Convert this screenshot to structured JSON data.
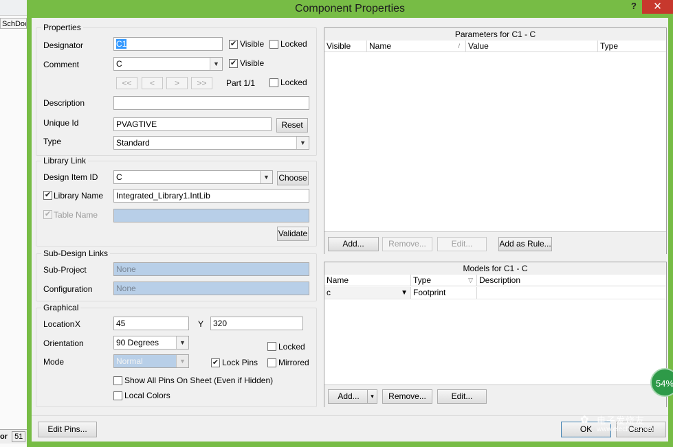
{
  "background_app": {
    "tab_label": "SchDoc",
    "bottom_left_label": "or",
    "bottom_tab_label": "51"
  },
  "dialog": {
    "title": "Component Properties",
    "help_label": "?",
    "close_label": "✕"
  },
  "properties": {
    "group_label": "Properties",
    "designator_label": "Designator",
    "designator_value": "C1",
    "designator_visible": "Visible",
    "designator_locked": "Locked",
    "comment_label": "Comment",
    "comment_value": "C",
    "comment_visible": "Visible",
    "nav_first": "<<",
    "nav_prev": "<",
    "nav_next": ">",
    "nav_last": ">>",
    "part_label": "Part 1/1",
    "part_locked": "Locked",
    "description_label": "Description",
    "description_value": "",
    "unique_id_label": "Unique Id",
    "unique_id_value": "PVAGTIVE",
    "reset_button": "Reset",
    "type_label": "Type",
    "type_value": "Standard"
  },
  "library_link": {
    "group_label": "Library Link",
    "design_item_label": "Design Item ID",
    "design_item_value": "C",
    "choose_button": "Choose",
    "library_name_label": "Library Name",
    "library_name_value": "Integrated_Library1.IntLib",
    "table_name_label": "Table Name",
    "validate_button": "Validate"
  },
  "sub_design": {
    "group_label": "Sub-Design Links",
    "sub_project_label": "Sub-Project",
    "sub_project_value": "None",
    "configuration_label": "Configuration",
    "configuration_value": "None"
  },
  "graphical": {
    "group_label": "Graphical",
    "location_label": "Location",
    "x_label": "X",
    "x_value": "45",
    "y_label": "Y",
    "y_value": "320",
    "orientation_label": "Orientation",
    "orientation_value": "90 Degrees",
    "locked_label": "Locked",
    "mode_label": "Mode",
    "mode_value": "Normal",
    "lock_pins_label": "Lock Pins",
    "mirrored_label": "Mirrored",
    "show_all_pins_label": "Show All Pins On Sheet (Even if Hidden)",
    "local_colors_label": "Local Colors"
  },
  "parameters": {
    "header": "Parameters for C1 - C",
    "columns": [
      "Visible",
      "Name",
      "Value",
      "Type"
    ],
    "sort_glyph": "/",
    "add_button": "Add...",
    "remove_button": "Remove...",
    "edit_button": "Edit...",
    "add_as_rule_button": "Add as Rule..."
  },
  "models": {
    "header": "Models for C1 - C",
    "columns": [
      "Name",
      "Type",
      "Description"
    ],
    "sort_glyph": "▽",
    "row": {
      "name": "c",
      "type": "Footprint",
      "description": ""
    },
    "add_button": "Add...",
    "add_dropdown": "▾",
    "remove_button": "Remove...",
    "edit_button": "Edit..."
  },
  "footer": {
    "edit_pins_button": "Edit Pins...",
    "ok_button": "OK",
    "cancel_button": "Cancel"
  },
  "overlay": {
    "progress_percent": 54,
    "progress_text": "54%",
    "watermark_text": "电子发烧友",
    "watermark_url": "www.elecfans.com"
  },
  "colors": {
    "title_bar": "#77bc45",
    "close_button": "#c7382d",
    "disabled_field": "#b8cfe8",
    "selection": "#3399ff"
  }
}
